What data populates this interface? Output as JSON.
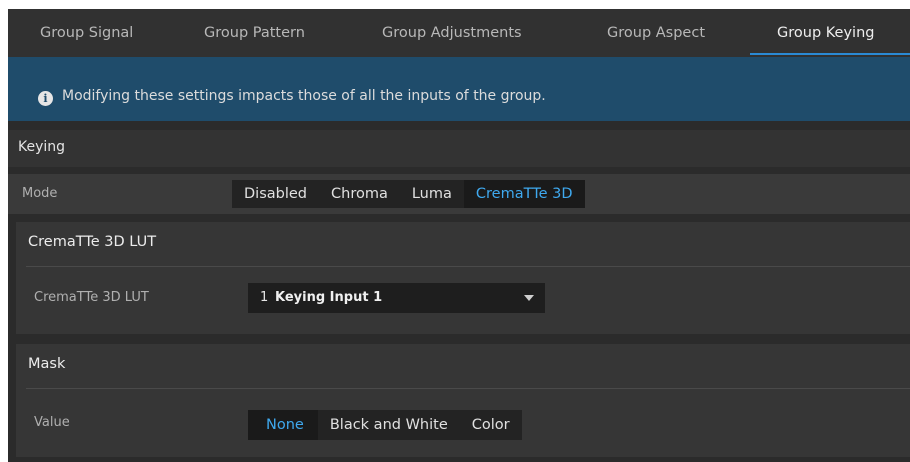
{
  "tabs": [
    {
      "label": "Group Signal",
      "active": false
    },
    {
      "label": "Group Pattern",
      "active": false
    },
    {
      "label": "Group Adjustments",
      "active": false
    },
    {
      "label": "Group Aspect",
      "active": false
    },
    {
      "label": "Group Keying",
      "active": true
    }
  ],
  "info": {
    "icon": "info-icon",
    "icon_glyph": "i",
    "text": "Modifying these settings impacts those of all the inputs of the group."
  },
  "keying": {
    "title": "Keying",
    "mode_label": "Mode",
    "mode_options": [
      "Disabled",
      "Chroma",
      "Luma",
      "CremaTTe 3D"
    ],
    "mode_selected": "CremaTTe 3D"
  },
  "lut_panel": {
    "title": "CremaTTe 3D LUT",
    "field_label": "CremaTTe 3D LUT",
    "dropdown_number": "1",
    "dropdown_value": "Keying Input 1"
  },
  "mask_panel": {
    "title": "Mask",
    "value_label": "Value",
    "options": [
      "None",
      "Black and White",
      "Color"
    ],
    "selected": "None"
  },
  "colors": {
    "accent": "#3fa9ef",
    "tab_underline": "#2a8ad4",
    "banner": "#1f4c6b",
    "background": "#2b2b2b"
  }
}
